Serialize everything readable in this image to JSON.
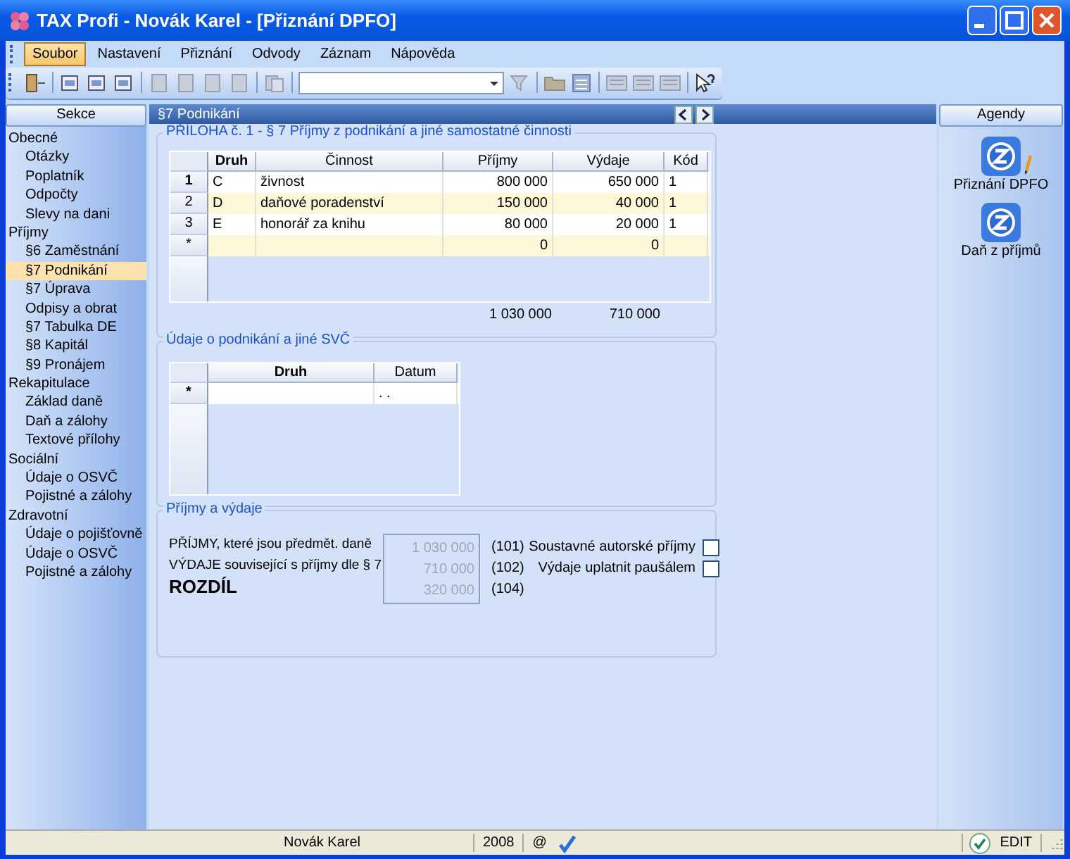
{
  "window": {
    "title": "TAX Profi - Novák Karel - [Přiznání DPFO]"
  },
  "menu": [
    {
      "label": "Soubor",
      "selected": true
    },
    {
      "label": "Nastavení",
      "selected": false
    },
    {
      "label": "Přiznání",
      "selected": false
    },
    {
      "label": "Odvody",
      "selected": false
    },
    {
      "label": "Záznam",
      "selected": false
    },
    {
      "label": "Nápověda",
      "selected": false
    }
  ],
  "sidebar": {
    "header": "Sekce",
    "items": [
      {
        "label": "Obecné",
        "selected": false,
        "children": [
          {
            "label": "Otázky",
            "selected": false
          },
          {
            "label": "Poplatník",
            "selected": false
          },
          {
            "label": "Odpočty",
            "selected": false
          },
          {
            "label": "Slevy na dani",
            "selected": false
          }
        ]
      },
      {
        "label": "Příjmy",
        "selected": false,
        "children": [
          {
            "label": "§6 Zaměstnání",
            "selected": false
          },
          {
            "label": "§7 Podnikání",
            "selected": true
          },
          {
            "label": "§7 Úprava",
            "selected": false
          },
          {
            "label": "Odpisy a obrat",
            "selected": false
          },
          {
            "label": "§7 Tabulka DE",
            "selected": false
          },
          {
            "label": "§8 Kapitál",
            "selected": false
          },
          {
            "label": "§9 Pronájem",
            "selected": false
          }
        ]
      },
      {
        "label": "Rekapitulace",
        "selected": false,
        "children": [
          {
            "label": "Základ daně",
            "selected": false
          },
          {
            "label": "Daň a zálohy",
            "selected": false
          },
          {
            "label": "Textové přílohy",
            "selected": false
          }
        ]
      },
      {
        "label": "Sociální",
        "selected": false,
        "children": [
          {
            "label": "Údaje o OSVČ",
            "selected": false
          },
          {
            "label": "Pojistné a zálohy",
            "selected": false
          }
        ]
      },
      {
        "label": "Zdravotní",
        "selected": false,
        "children": [
          {
            "label": "Údaje o pojišťovně",
            "selected": false
          },
          {
            "label": "Údaje o OSVČ",
            "selected": false
          },
          {
            "label": "Pojistné a zálohy",
            "selected": false
          }
        ]
      }
    ]
  },
  "content": {
    "header": "§7 Podnikání",
    "income_section": {
      "title": "PŘÍLOHA č. 1 - § 7 Příjmy z podnikání a jiné samostatné činnosti",
      "columns": [
        {
          "label": "Druh",
          "current": true
        },
        {
          "label": "Činnost",
          "current": false
        },
        {
          "label": "Příjmy",
          "current": false
        },
        {
          "label": "Výdaje",
          "current": false
        },
        {
          "label": "Kód",
          "current": false
        }
      ],
      "rows": [
        {
          "header": "1",
          "selected": true,
          "cells": [
            "C",
            "živnost",
            "800 000",
            "650 000",
            "1"
          ]
        },
        {
          "header": "2",
          "selected": false,
          "cells": [
            "D",
            "daňové poradenství",
            "150 000",
            "40 000",
            "1"
          ]
        },
        {
          "header": "3",
          "selected": false,
          "cells": [
            "E",
            "honorář za knihu",
            "80 000",
            "20 000",
            "1"
          ]
        },
        {
          "header": "*",
          "selected": false,
          "cells": [
            "",
            "",
            "0",
            "0",
            ""
          ]
        }
      ],
      "totals": [
        "1 030 000",
        "710 000"
      ]
    },
    "business_section": {
      "title": "Údaje o podnikání a jiné SVČ",
      "columns": [
        "Druh",
        "Datum"
      ],
      "rows": [
        {
          "header": "*",
          "cells": [
            "",
            ". ."
          ]
        }
      ]
    },
    "summary_section": {
      "title": "Příjmy a výdaje",
      "lines": [
        {
          "label": "PŘÍJMY, které jsou předmět. daně",
          "value": "1 030 000",
          "code": "(101)",
          "kind": "normal"
        },
        {
          "label": "VÝDAJE související s příjmy dle § 7",
          "value": "710 000",
          "code": "(102)",
          "kind": "normal"
        },
        {
          "label": "ROZDÍL",
          "value": "320 000",
          "code": "(104)",
          "kind": "result"
        }
      ],
      "checkboxes": [
        {
          "label": "Soustavné autorské příjmy",
          "checked": false
        },
        {
          "label": "Výdaje uplatnit paušálem",
          "checked": false
        }
      ]
    }
  },
  "agendas": {
    "header": "Agendy",
    "items": [
      {
        "label": "Přiznání DPFO",
        "selected": true
      },
      {
        "label": "Daň z příjmů",
        "selected": false
      }
    ]
  },
  "status_bar": {
    "user": "Novák Karel",
    "year": "2008",
    "mail": "@",
    "mode": "EDIT"
  }
}
